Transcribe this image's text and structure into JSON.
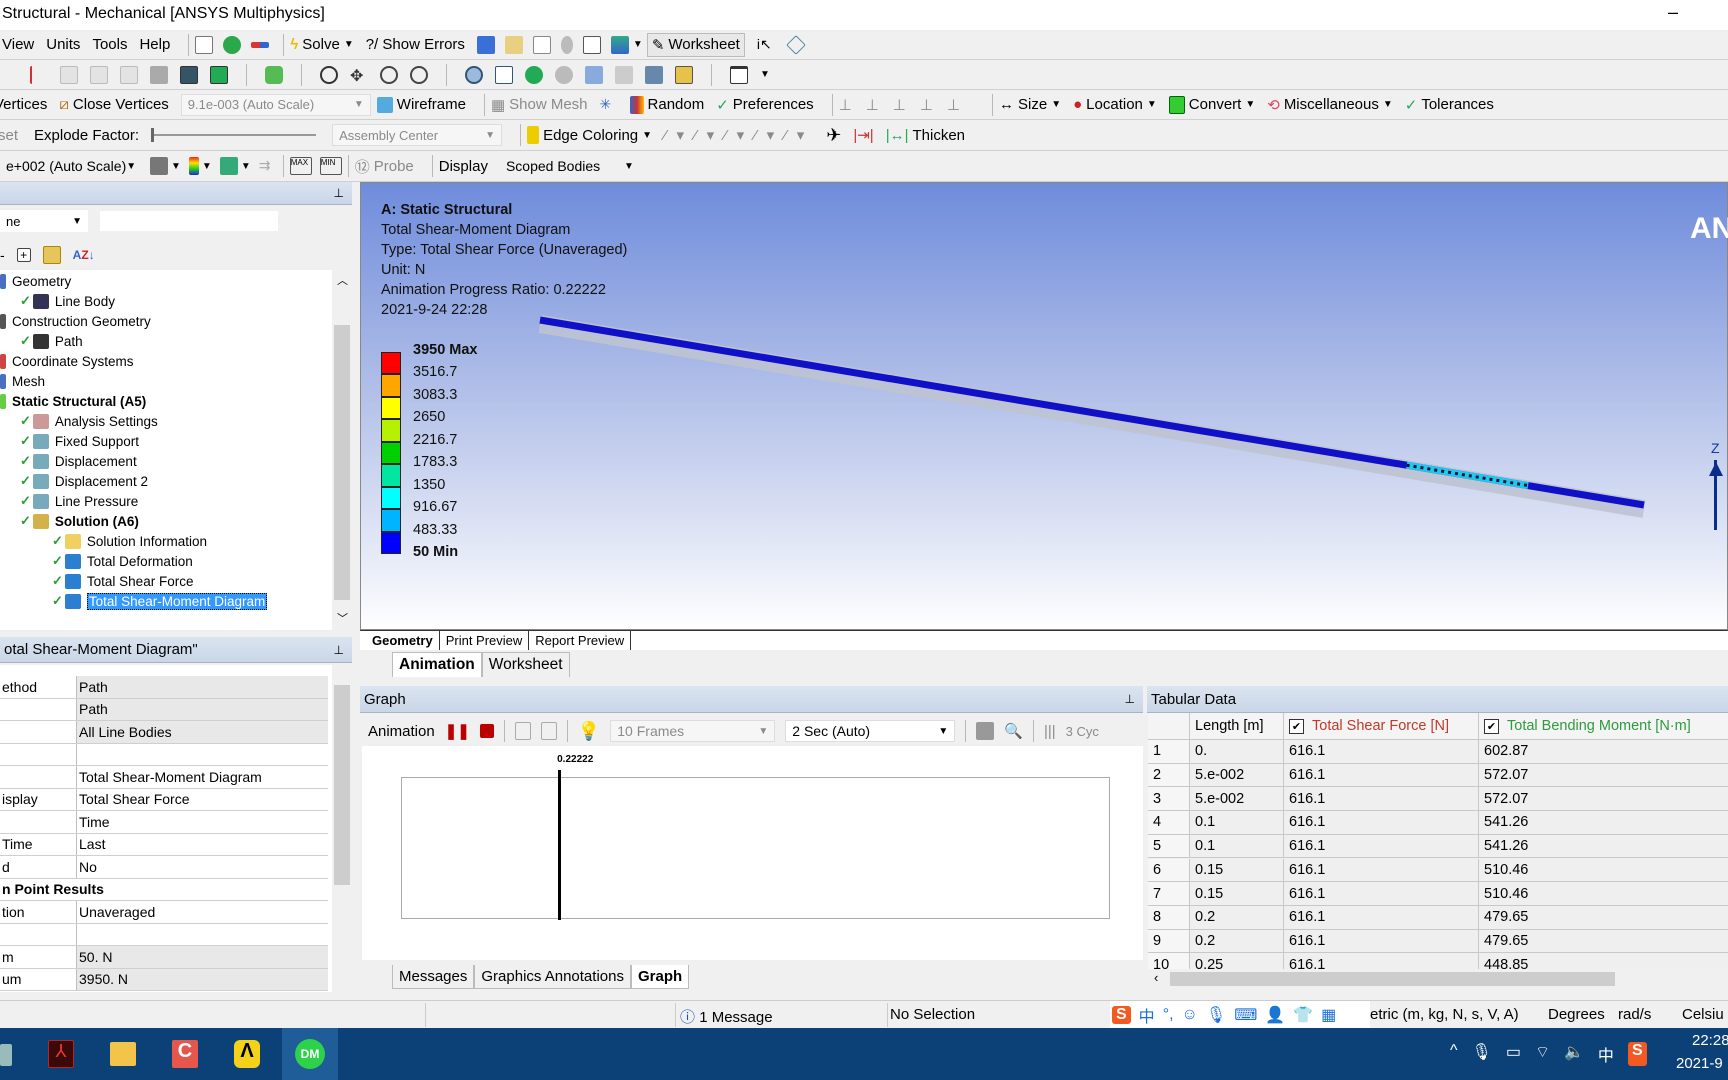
{
  "window": {
    "title": "Structural - Mechanical [ANSYS Multiphysics]",
    "minimize": "–"
  },
  "menu": [
    "View",
    "Units",
    "Tools",
    "Help"
  ],
  "toolbar1": {
    "solve": "Solve",
    "show_errors": "?/ Show Errors",
    "worksheet": "Worksheet"
  },
  "toolbar3": {
    "vertices": "Vertices",
    "close_vertices": "Close Vertices",
    "scale": "9.1e-003 (Auto Scale)",
    "wireframe": "Wireframe",
    "show_mesh": "Show Mesh",
    "random": "Random",
    "preferences": "Preferences",
    "size": "Size",
    "location": "Location",
    "convert": "Convert",
    "miscellaneous": "Miscellaneous",
    "tolerances": "Tolerances"
  },
  "toolbar4": {
    "reset": "set",
    "explode_factor": "Explode Factor:",
    "assembly_center": "Assembly Center",
    "edge_coloring": "Edge Coloring",
    "thicken": "Thicken"
  },
  "toolbar5": {
    "scale": "e+002 (Auto Scale)",
    "probe": "Probe",
    "display_label": "Display",
    "display_value": "Scoped Bodies"
  },
  "outline": {
    "filter": "ne",
    "items": [
      {
        "label": "Geometry",
        "level": 0,
        "bold": false,
        "icon": "geometry-icon"
      },
      {
        "label": "Line Body",
        "level": 1,
        "bold": false,
        "icon": "line-body-icon"
      },
      {
        "label": "Construction Geometry",
        "level": 0,
        "bold": false,
        "icon": "construction-geometry-icon"
      },
      {
        "label": "Path",
        "level": 1,
        "bold": false,
        "icon": "path-icon"
      },
      {
        "label": "Coordinate Systems",
        "level": 0,
        "bold": false,
        "icon": "coordinate-systems-icon"
      },
      {
        "label": "Mesh",
        "level": 0,
        "bold": false,
        "icon": "mesh-icon"
      },
      {
        "label": "Static Structural (A5)",
        "level": 0,
        "bold": true,
        "icon": "static-structural-icon"
      },
      {
        "label": "Analysis Settings",
        "level": 1,
        "bold": false,
        "icon": "analysis-settings-icon"
      },
      {
        "label": "Fixed Support",
        "level": 1,
        "bold": false,
        "icon": "fixed-support-icon"
      },
      {
        "label": "Displacement",
        "level": 1,
        "bold": false,
        "icon": "displacement-icon"
      },
      {
        "label": "Displacement 2",
        "level": 1,
        "bold": false,
        "icon": "displacement-icon"
      },
      {
        "label": "Line Pressure",
        "level": 1,
        "bold": false,
        "icon": "line-pressure-icon"
      },
      {
        "label": "Solution (A6)",
        "level": 1,
        "bold": true,
        "icon": "solution-icon"
      },
      {
        "label": "Solution Information",
        "level": 2,
        "bold": false,
        "icon": "solution-information-icon"
      },
      {
        "label": "Total Deformation",
        "level": 2,
        "bold": false,
        "icon": "result-icon"
      },
      {
        "label": "Total Shear Force",
        "level": 2,
        "bold": false,
        "icon": "result-icon"
      },
      {
        "label": "Total Shear-Moment Diagram",
        "level": 2,
        "bold": false,
        "icon": "result-icon",
        "selected": true
      }
    ]
  },
  "details": {
    "title": "otal Shear-Moment Diagram\"",
    "rows": [
      {
        "k": "ethod",
        "v": "Path",
        "shaded": true
      },
      {
        "k": "",
        "v": "Path",
        "shaded": true
      },
      {
        "k": "",
        "v": "All Line Bodies",
        "shaded": true
      },
      {
        "k": "",
        "v": "",
        "shaded": false
      },
      {
        "k": "",
        "v": "Total Shear-Moment Diagram",
        "shaded": false
      },
      {
        "k": "isplay",
        "v": "Total Shear Force",
        "shaded": false
      },
      {
        "k": "",
        "v": "Time",
        "shaded": false
      },
      {
        "k": " Time",
        "v": "Last",
        "shaded": false
      },
      {
        "k": "d",
        "v": "No",
        "shaded": false
      },
      {
        "k": "n Point Results",
        "v": "",
        "section": true
      },
      {
        "k": "tion",
        "v": "Unaveraged",
        "shaded": false
      },
      {
        "k": "",
        "v": "",
        "shaded": false
      },
      {
        "k": "m",
        "v": "50. N",
        "shaded": true
      },
      {
        "k": "um",
        "v": "3950. N",
        "shaded": true
      }
    ]
  },
  "viewport": {
    "info": [
      "A: Static Structural",
      "Total Shear-Moment Diagram",
      "Type: Total Shear Force (Unaveraged)",
      "Unit: N",
      "Animation Progress Ratio: 0.22222",
      "2021-9-24 22:28"
    ],
    "legend": {
      "labels": [
        "3950 Max",
        "3516.7",
        "3083.3",
        "2650",
        "2216.7",
        "1783.3",
        "1350",
        "916.67",
        "483.33",
        "50 Min"
      ],
      "colors": [
        "#ff0000",
        "#ffa500",
        "#ffff00",
        "#b4f000",
        "#00d000",
        "#00e6a0",
        "#00ffff",
        "#00b4ff",
        "#0000ff"
      ]
    },
    "logo": "AN",
    "axis_label": "Z",
    "tabs": [
      "Geometry",
      "Print Preview",
      "Report Preview"
    ]
  },
  "subtabs": [
    "Animation",
    "Worksheet"
  ],
  "graph": {
    "title": "Graph",
    "animation_label": "Animation",
    "frames": "10 Frames",
    "duration": "2 Sec (Auto)",
    "cycles": "3 Cyc",
    "progress_ratio": 0.22222,
    "marker_label": "0.22222",
    "bottom_tabs": [
      "Messages",
      "Graphics Annotations",
      "Graph"
    ]
  },
  "tabular": {
    "title": "Tabular Data",
    "columns": [
      "Length [m]",
      "Total Shear Force [N]",
      "Total Bending Moment [N·m]"
    ],
    "rows": [
      [
        "1",
        "0.",
        "616.1",
        "602.87"
      ],
      [
        "2",
        "5.e-002",
        "616.1",
        "572.07"
      ],
      [
        "3",
        "5.e-002",
        "616.1",
        "572.07"
      ],
      [
        "4",
        "0.1",
        "616.1",
        "541.26"
      ],
      [
        "5",
        "0.1",
        "616.1",
        "541.26"
      ],
      [
        "6",
        "0.15",
        "616.1",
        "510.46"
      ],
      [
        "7",
        "0.15",
        "616.1",
        "510.46"
      ],
      [
        "8",
        "0.2",
        "616.1",
        "479.65"
      ],
      [
        "9",
        "0.2",
        "616.1",
        "479.65"
      ],
      [
        "10",
        "0.25",
        "616.1",
        "448.85"
      ]
    ]
  },
  "status": {
    "messages": "1 Message",
    "selection": "No Selection",
    "units": "etric (m, kg, N, s, V, A)",
    "angle": "Degrees",
    "rot": "rad/s",
    "temp": "Celsiu"
  },
  "ime": {
    "lang": "中"
  },
  "taskbar": {
    "clock_time": "22:28",
    "clock_date": "2021-9",
    "tray_lang": "中",
    "apps": [
      "pdf-app",
      "file-explorer",
      "c-app",
      "a-app",
      "dm-app"
    ]
  }
}
